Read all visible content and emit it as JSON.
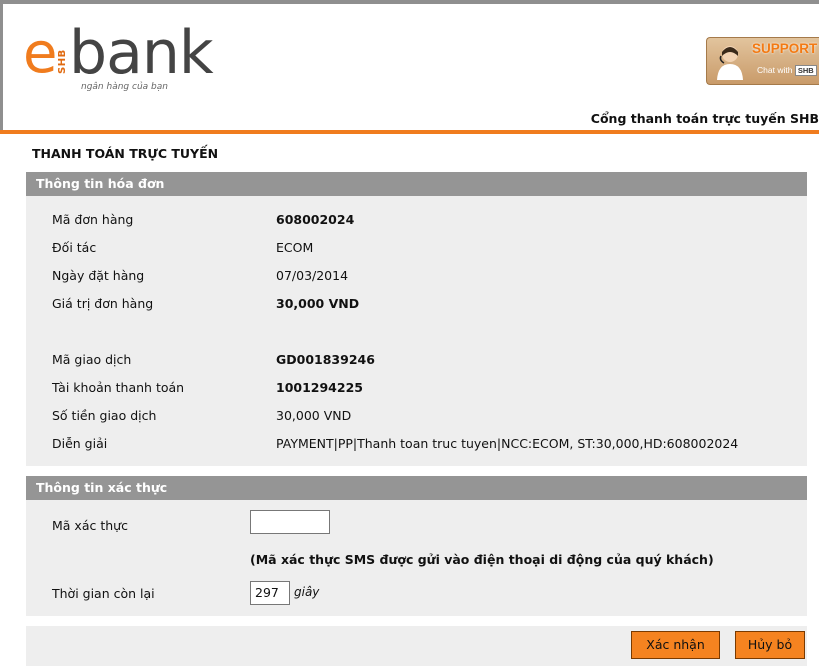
{
  "header": {
    "logo_prefix": "e",
    "logo_badge": "SHB",
    "logo_word": "bank",
    "logo_tagline": "ngân hàng của bạn",
    "support_title": "SUPPORT",
    "support_chat_label": "Chat with",
    "support_chat_brand": "SHB",
    "portal_title": "Cổng thanh toán trực tuyến SHB"
  },
  "page_heading": "THANH TOÁN TRỰC TUYẾN",
  "invoice": {
    "section_title": "Thông tin hóa đơn",
    "rows": [
      {
        "label": "Mã đơn hàng",
        "value": "608002024"
      },
      {
        "label": "Đối tác",
        "value": "ECOM"
      },
      {
        "label": "Ngày đặt hàng",
        "value": "07/03/2014"
      },
      {
        "label": "Giá trị đơn hàng",
        "value": "30,000 VND"
      },
      {
        "label": "Mã giao dịch",
        "value": "GD001839246"
      },
      {
        "label": "Tài khoản thanh toán",
        "value": "1001294225"
      },
      {
        "label": "Số tiền giao dịch",
        "value": "30,000  VND"
      },
      {
        "label": "Diễn giải",
        "value": "PAYMENT|PP|Thanh toan truc tuyen|NCC:ECOM, ST:30,000,HD:608002024"
      }
    ]
  },
  "auth": {
    "section_title": "Thông tin xác thực",
    "otp_label": "Mã xác thực",
    "otp_value": "",
    "sms_note": "(Mã xác thực SMS được gửi vào điện thoại di động của quý khách)",
    "time_label": "Thời gian còn lại",
    "time_value": "297",
    "time_unit": "giây"
  },
  "actions": {
    "confirm_label": "Xác nhận",
    "cancel_label": "Hủy bỏ"
  },
  "colors": {
    "accent": "#f07c1e",
    "section_header": "#959595",
    "panel_bg": "#eeeeee",
    "button_bg": "#f58320"
  },
  "icons": {
    "support": "support-agent-icon"
  }
}
